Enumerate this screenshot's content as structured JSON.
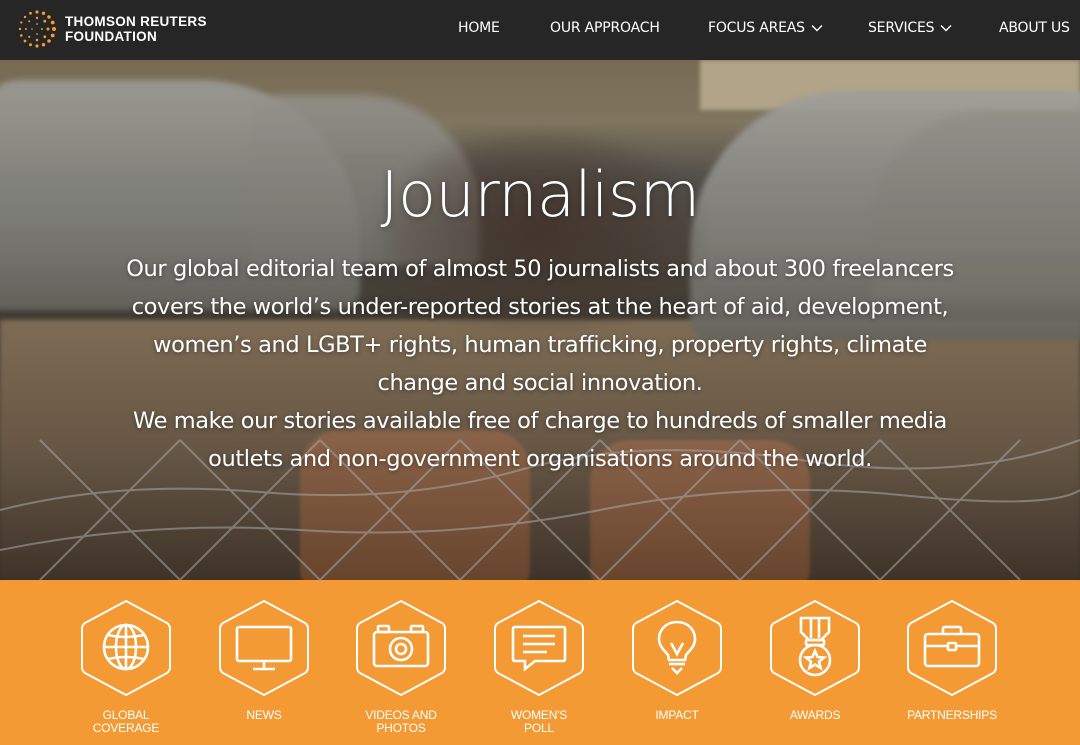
{
  "brand": {
    "name_line1": "THOMSON REUTERS",
    "name_line2": "FOUNDATION",
    "accent": "#f39a35"
  },
  "nav": {
    "items": [
      {
        "label": "HOME",
        "has_dropdown": false
      },
      {
        "label": "OUR APPROACH",
        "has_dropdown": false
      },
      {
        "label": "FOCUS AREAS",
        "has_dropdown": true
      },
      {
        "label": "SERVICES",
        "has_dropdown": true
      },
      {
        "label": "ABOUT US",
        "has_dropdown": false
      }
    ]
  },
  "hero": {
    "title": "Journalism",
    "paragraph1": "Our global editorial team of almost 50 journalists and about 300 freelancers covers the world’s under-reported stories at the heart of aid, development, women’s and LGBT+ rights, human trafficking, property rights, climate change and social innovation.",
    "paragraph2": "We make our stories available free of charge to hundreds of smaller media outlets and non-government organisations around the world."
  },
  "tiles": [
    {
      "label": "GLOBAL\nCOVERAGE",
      "icon": "globe-icon"
    },
    {
      "label": "NEWS",
      "icon": "monitor-icon"
    },
    {
      "label": "VIDEOS AND\nPHOTOS",
      "icon": "camera-icon"
    },
    {
      "label": "WOMEN'S\nPOLL",
      "icon": "speech-bubble-icon"
    },
    {
      "label": "IMPACT",
      "icon": "lightbulb-icon"
    },
    {
      "label": "AWARDS",
      "icon": "medal-icon"
    },
    {
      "label": "PARTNERSHIPS",
      "icon": "briefcase-icon"
    }
  ]
}
